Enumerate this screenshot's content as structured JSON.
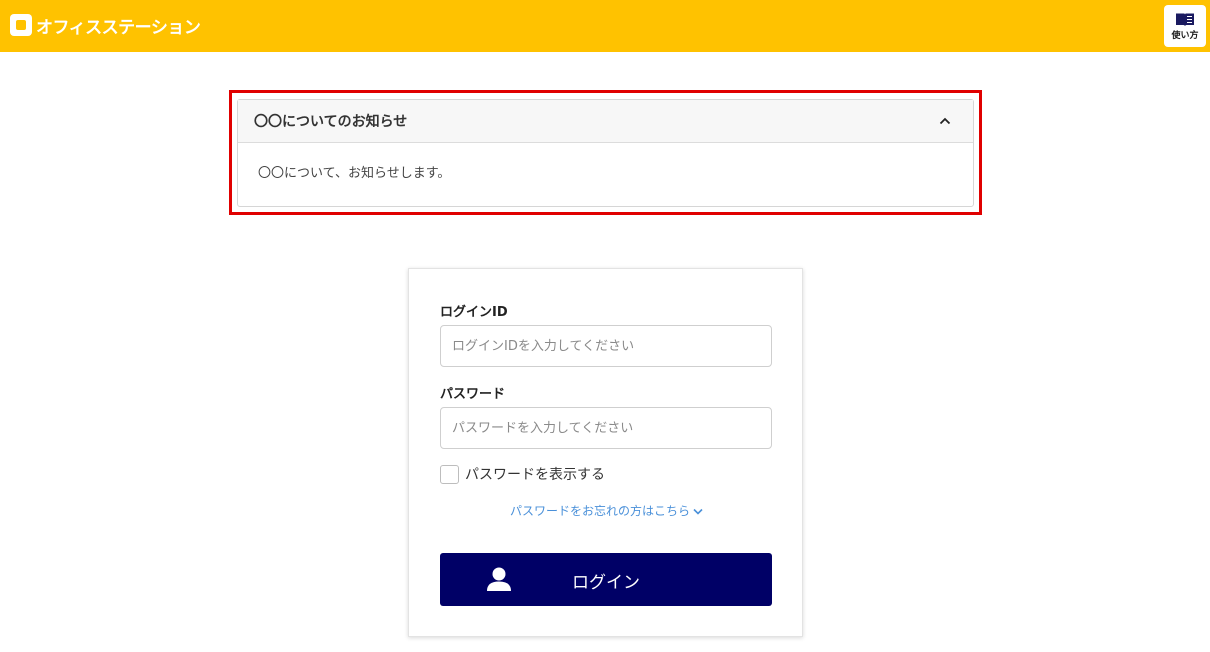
{
  "header": {
    "brand": "オフィスステーション",
    "help_label": "使い方",
    "colors": {
      "bar": "#ffc200"
    }
  },
  "notice": {
    "title": "〇〇についてのお知らせ",
    "body": "〇〇について、お知らせします。",
    "toggle_icon": "chevron-up-icon",
    "highlight_color": "#e00000"
  },
  "login": {
    "id_label": "ログインID",
    "id_placeholder": "ログインIDを入力してください",
    "id_value": "",
    "password_label": "パスワード",
    "password_placeholder": "パスワードを入力してください",
    "password_value": "",
    "show_password_label": "パスワードを表示する",
    "forgot_link": "パスワードをお忘れの方はこちら",
    "button_label": "ログイン",
    "button_color": "#000066",
    "link_color": "#4a90d9"
  }
}
